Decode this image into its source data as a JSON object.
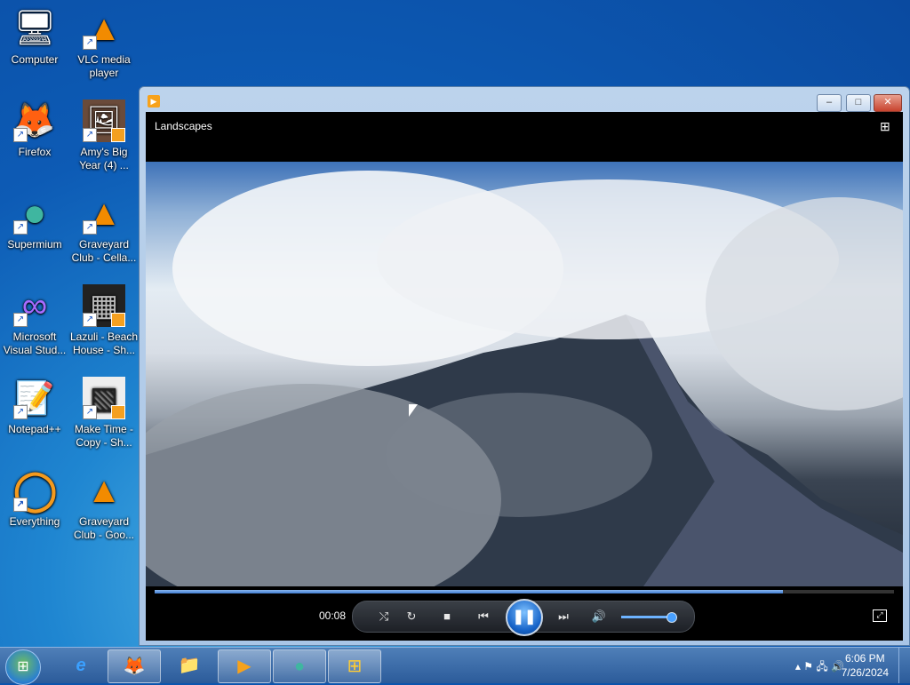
{
  "desktop": {
    "icons": [
      {
        "label": "Computer",
        "glyph": "🖥"
      },
      {
        "label": "VLC media player",
        "glyph": "▲"
      },
      {
        "label": "Firefox",
        "glyph": "🦊"
      },
      {
        "label": "Amy's Big Year (4) ...",
        "glyph": "🖼"
      },
      {
        "label": "Supermium",
        "glyph": "●"
      },
      {
        "label": "Graveyard Club - Cella...",
        "glyph": "▲"
      },
      {
        "label": "Microsoft Visual Stud...",
        "glyph": "∞"
      },
      {
        "label": "Lazuli - Beach House - Sh...",
        "glyph": "▦"
      },
      {
        "label": "Notepad++",
        "glyph": "📝"
      },
      {
        "label": "Make Time - Copy - Sh...",
        "glyph": "▧"
      },
      {
        "label": "Everything",
        "glyph": "◯"
      },
      {
        "label": "Graveyard Club - Goo...",
        "glyph": "▲"
      }
    ]
  },
  "window": {
    "title_icon": "media-player-icon",
    "minimize": "–",
    "maximize": "□",
    "close": "✕"
  },
  "player": {
    "playlist_title": "Landscapes",
    "layout_icon": "switch-to-library-icon",
    "elapsed": "00:08",
    "seek_progress": 0.85,
    "volume_level": 0.9,
    "buttons": {
      "shuffle": "⤭",
      "repeat": "↻",
      "stop": "■",
      "previous": "⏮",
      "play_pause": "❚❚",
      "next": "⏭",
      "mute": "🔊",
      "fullscreen": "⤢"
    }
  },
  "taskbar": {
    "apps": [
      {
        "name": "Internet Explorer",
        "glyph": "e",
        "active": false
      },
      {
        "name": "Firefox",
        "glyph": "🦊",
        "active": true
      },
      {
        "name": "Windows Explorer",
        "glyph": "📁",
        "active": false
      },
      {
        "name": "Windows Media Player",
        "glyph": "▶",
        "active": true
      },
      {
        "name": "Supermium",
        "glyph": "●",
        "active": true
      },
      {
        "name": "Windows",
        "glyph": "⊞",
        "active": true
      }
    ],
    "tray_icons": "▴ ⚑ 🖧 🔊",
    "time": "6:06 PM",
    "date": "7/26/2024"
  },
  "colors": {
    "accent": "#1663c8",
    "seek_fill": "#3f7bd0"
  }
}
